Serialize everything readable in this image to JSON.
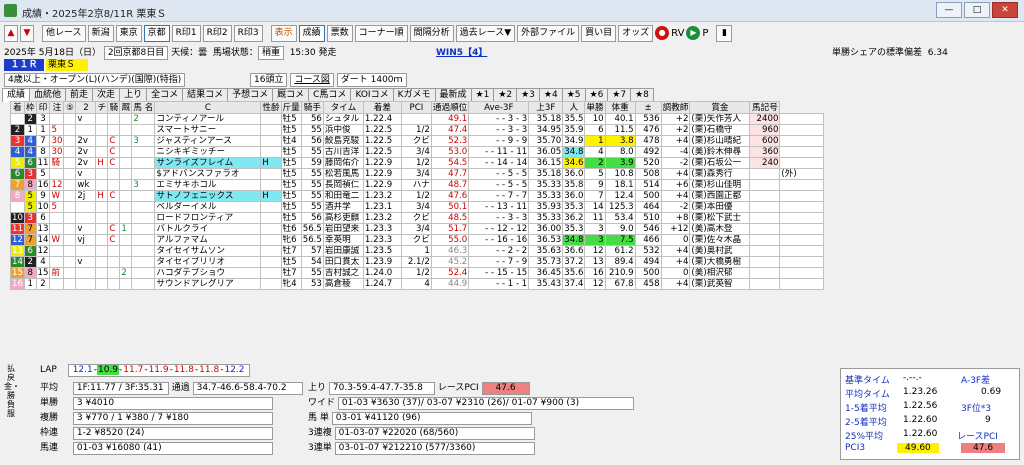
{
  "window": {
    "title": "成績・2025年2京8/11R 栗東Ｓ"
  },
  "toolbar": {
    "items": [
      "他レース",
      "新潟",
      "東京",
      "京都",
      "R印1",
      "R印2",
      "R印3",
      "表示",
      "成績",
      "票数",
      "コーナー順",
      "間隔分析",
      "過去レース▼",
      "外部ファイル",
      "買い目",
      "オッズ",
      "RV",
      "P"
    ]
  },
  "race": {
    "date": "2025年 5月18日（日）",
    "kai": "2回京都8日目",
    "weather_label": "天候：",
    "weather": "曇",
    "track_label": "馬場状態：",
    "track": "稍重",
    "start": "15:30 発走",
    "win5": "WIN5【4】",
    "share_label": "単勝シェアの標準偏差",
    "share": "6.34",
    "rno": "１１Ｒ",
    "name": "栗東Ｓ",
    "cond": "4歳以上・オープン(L)(ハンデ)(国際)(特指)",
    "heads": "16頭立",
    "course_btn": "コース図",
    "course": "ダート 1400ｍ"
  },
  "tabs": [
    "成績",
    "血統他",
    "前走",
    "次走",
    "上り",
    "全コメ",
    "結果コメ",
    "予想コメ",
    "厩コメ",
    "C馬コメ",
    "KOIコメ",
    "Kガメモ",
    "最新成",
    "★1",
    "★2",
    "★3",
    "★4",
    "★5",
    "★6",
    "★7",
    "★8"
  ],
  "columns": [
    "着",
    "枠",
    "印",
    "注",
    "⑤",
    "2",
    "チ",
    "騎",
    "厩",
    "馬 名",
    "C",
    "性齢",
    "斤量",
    "騎手",
    "タイム",
    "着差",
    "PCI",
    "通過順位",
    "Ave-3F",
    "上3F",
    "人",
    "単勝",
    "体重",
    "±",
    "調教師",
    "賞金",
    "馬記号"
  ],
  "rows": [
    {
      "ch": "1",
      "wak": "2",
      "ban": "3",
      "ma": "",
      "chu": "",
      "m5": "v",
      "m2": "",
      "chi": "",
      "ki": "",
      "kyu": "2",
      "name": "コンティノアール",
      "c": "",
      "sei": "牡5",
      "kin": "56",
      "jock": "シュタル",
      "time": "1.22.4",
      "sa": "",
      "pci": "49.1",
      "pass": "- - 3 - 3",
      "ave": "35.18",
      "up": "35.5",
      "nin": "10",
      "tan": "40.1",
      "wt": "536",
      "pm": "+2",
      "tr": "(栗)矢作芳人",
      "prize": "2400",
      "mark": ""
    },
    {
      "ch": "2",
      "wak": "1",
      "ban": "1",
      "ma": "5",
      "chu": "",
      "m5": "",
      "m2": "",
      "chi": "",
      "ki": "",
      "kyu": "",
      "name": "スマートサニー",
      "c": "",
      "sei": "牡5",
      "kin": "55",
      "jock": "浜中俊",
      "time": "1.22.5",
      "sa": "1/2",
      "pci": "47.4",
      "pass": "- - 3 - 3",
      "ave": "34.95",
      "up": "35.9",
      "nin": "6",
      "tan": "11.5",
      "wt": "476",
      "pm": "+2",
      "tr": "(栗)石橋守",
      "prize": "960",
      "mark": ""
    },
    {
      "ch": "3",
      "wak": "4",
      "ban": "7",
      "ma": "30",
      "chu": "",
      "m5": "2v",
      "m2": "",
      "chi": "C",
      "ki": "",
      "kyu": "3",
      "name": "ジャスティンアース",
      "c": "",
      "sei": "牡4",
      "kin": "56",
      "jock": "鮫島克駿",
      "time": "1.22.5",
      "sa": "クビ",
      "pci": "52.3",
      "pass": "- - 9 - 9",
      "ave": "35.70",
      "up": "34.9",
      "nin": "1",
      "tan": "3.8",
      "wt": "478",
      "pm": "+4",
      "tr": "(栗)杉山晴紀",
      "prize": "600",
      "mark": ""
    },
    {
      "ch": "4",
      "wak": "4",
      "ban": "8",
      "ma": "30",
      "chu": "",
      "m5": "2v",
      "m2": "",
      "chi": "C",
      "ki": "",
      "kyu": "",
      "name": "ニシキギミッチー",
      "c": "",
      "sei": "牡5",
      "kin": "55",
      "jock": "古川吉洋",
      "time": "1.22.5",
      "sa": "3/4",
      "pci": "53.0",
      "pass": "- - 11 - 11",
      "ave": "36.05",
      "up": "34.8",
      "nin": "4",
      "tan": "8.0",
      "wt": "492",
      "pm": "-4",
      "tr": "(美)鈴木伸尋",
      "prize": "360",
      "mark": ""
    },
    {
      "ch": "5",
      "wak": "6",
      "ban": "11",
      "ma": "騎",
      "chu": "",
      "m5": "2v",
      "m2": "H",
      "chi": "C",
      "ki": "",
      "kyu": "",
      "name": "サンライズフレイム",
      "c": "H",
      "sei": "牡5",
      "kin": "59",
      "jock": "藤岡佑介",
      "time": "1.22.9",
      "sa": "1/2",
      "pci": "54.5",
      "pass": "- - 14 - 14",
      "ave": "36.15",
      "up": "34.6",
      "nin": "2",
      "tan": "3.9",
      "wt": "520",
      "pm": "-2",
      "tr": "(栗)石坂公一",
      "prize": "240",
      "mark": ""
    },
    {
      "ch": "6",
      "wak": "3",
      "ban": "5",
      "ma": "",
      "chu": "",
      "m5": "v",
      "m2": "",
      "chi": "",
      "ki": "",
      "kyu": "",
      "name": "$アドバンスファラオ",
      "c": "",
      "sei": "牡5",
      "kin": "55",
      "jock": "松若風馬",
      "time": "1.22.9",
      "sa": "3/4",
      "pci": "47.7",
      "pass": "- - 5 - 5",
      "ave": "35.18",
      "up": "36.0",
      "nin": "5",
      "tan": "10.8",
      "wt": "508",
      "pm": "+4",
      "tr": "(栗)森秀行",
      "prize": "",
      "mark": "(外)"
    },
    {
      "ch": "7",
      "wak": "8",
      "ban": "16",
      "ma": "12",
      "chu": "",
      "m5": "wk",
      "m2": "",
      "chi": "",
      "ki": "",
      "kyu": "3",
      "name": "エミサキホコル",
      "c": "",
      "sei": "牡5",
      "kin": "55",
      "jock": "長岡禎仁",
      "time": "1.22.9",
      "sa": "ハナ",
      "pci": "48.7",
      "pass": "- - 5 - 5",
      "ave": "35.33",
      "up": "35.8",
      "nin": "9",
      "tan": "18.1",
      "wt": "514",
      "pm": "+6",
      "tr": "(栗)杉山佳明",
      "prize": "",
      "mark": ""
    },
    {
      "ch": "8",
      "wak": "5",
      "ban": "9",
      "ma": "W",
      "chu": "",
      "m5": "2j",
      "m2": "H",
      "chi": "C",
      "ki": "",
      "kyu": "",
      "name": "サトノフェニックス",
      "c": "H",
      "sei": "牡5",
      "kin": "55",
      "jock": "和田竜二",
      "time": "1.23.2",
      "sa": "1/2",
      "pci": "47.6",
      "pass": "- - 7 - 7",
      "ave": "35.33",
      "up": "36.0",
      "nin": "7",
      "tan": "12.4",
      "wt": "500",
      "pm": "+4",
      "tr": "(栗)西園正都",
      "prize": "",
      "mark": ""
    },
    {
      "ch": "9",
      "wak": "5",
      "ban": "10",
      "ma": "5",
      "chu": "",
      "m5": "",
      "m2": "",
      "chi": "",
      "ki": "",
      "kyu": "",
      "name": "ベルダーイメル",
      "c": "",
      "sei": "牡5",
      "kin": "55",
      "jock": "酒井学",
      "time": "1.23.1",
      "sa": "3/4",
      "pci": "50.1",
      "pass": "- - 13 - 11",
      "ave": "35.93",
      "up": "35.3",
      "nin": "14",
      "tan": "125.3",
      "wt": "464",
      "pm": "-2",
      "tr": "(栗)本田優",
      "prize": "",
      "mark": ""
    },
    {
      "ch": "10",
      "wak": "3",
      "ban": "6",
      "ma": "",
      "chu": "",
      "m5": "",
      "m2": "",
      "chi": "",
      "ki": "",
      "kyu": "",
      "name": "ロードフロンティア",
      "c": "",
      "sei": "牡5",
      "kin": "56",
      "jock": "高杉吏麒",
      "time": "1.23.2",
      "sa": "クビ",
      "pci": "48.5",
      "pass": "- - 3 - 3",
      "ave": "35.33",
      "up": "36.2",
      "nin": "11",
      "tan": "53.4",
      "wt": "510",
      "pm": "+8",
      "tr": "(栗)松下武士",
      "prize": "",
      "mark": ""
    },
    {
      "ch": "11",
      "wak": "7",
      "ban": "13",
      "ma": "",
      "chu": "",
      "m5": "v",
      "m2": "",
      "chi": "C",
      "ki": "1",
      "kyu": "",
      "name": "バトルクライ",
      "c": "",
      "sei": "牡6",
      "kin": "56.5",
      "jock": "岩田望来",
      "time": "1.23.3",
      "sa": "3/4",
      "pci": "51.7",
      "pass": "- - 12 - 12",
      "ave": "36.00",
      "up": "35.3",
      "nin": "3",
      "tan": "9.0",
      "wt": "546",
      "pm": "+12",
      "tr": "(美)高木登",
      "prize": "",
      "mark": ""
    },
    {
      "ch": "12",
      "wak": "7",
      "ban": "14",
      "ma": "W",
      "chu": "",
      "m5": "vj",
      "m2": "",
      "chi": "C",
      "ki": "",
      "kyu": "",
      "name": "アルファマム",
      "c": "",
      "sei": "牝6",
      "kin": "56.5",
      "jock": "幸英明",
      "time": "1.23.3",
      "sa": "クビ",
      "pci": "55.0",
      "pass": "- - 16 - 16",
      "ave": "36.53",
      "up": "34.8",
      "nin": "3",
      "tan": "7.5",
      "wt": "466",
      "pm": "0",
      "tr": "(栗)佐々木晶",
      "prize": "",
      "mark": ""
    },
    {
      "ch": "13",
      "wak": "6",
      "ban": "12",
      "ma": "",
      "chu": "",
      "m5": "",
      "m2": "",
      "chi": "",
      "ki": "",
      "kyu": "",
      "name": "タイセイサムソン",
      "c": "",
      "sei": "牡7",
      "kin": "57",
      "jock": "岩田康誠",
      "time": "1.23.5",
      "sa": "1",
      "pci": "46.3",
      "pass": "- - 2 - 2",
      "ave": "35.63",
      "up": "36.6",
      "nin": "12",
      "tan": "61.2",
      "wt": "532",
      "pm": "+4",
      "tr": "(美)奥村武",
      "prize": "",
      "mark": ""
    },
    {
      "ch": "14",
      "wak": "2",
      "ban": "4",
      "ma": "",
      "chu": "",
      "m5": "v",
      "m2": "",
      "chi": "",
      "ki": "",
      "kyu": "",
      "name": "タイセイブリリオ",
      "c": "",
      "sei": "牡5",
      "kin": "54",
      "jock": "田口貫太",
      "time": "1.23.9",
      "sa": "2.1/2",
      "pci": "45.2",
      "pass": "- - 7 - 9",
      "ave": "35.73",
      "up": "37.2",
      "nin": "13",
      "tan": "89.4",
      "wt": "494",
      "pm": "+4",
      "tr": "(栗)大橋勇樹",
      "prize": "",
      "mark": ""
    },
    {
      "ch": "15",
      "wak": "8",
      "ban": "15",
      "ma": "前",
      "chu": "",
      "m5": "",
      "m2": "",
      "chi": "",
      "ki": "2",
      "kyu": "",
      "name": "ハコダテブショウ",
      "c": "",
      "sei": "牡7",
      "kin": "55",
      "jock": "吉村誠之",
      "time": "1.24.0",
      "sa": "1/2",
      "pci": "52.4",
      "pass": "- - 15 - 15",
      "ave": "36.45",
      "up": "35.6",
      "nin": "16",
      "tan": "210.9",
      "wt": "500",
      "pm": "0",
      "tr": "(美)相沢郁",
      "prize": "",
      "mark": ""
    },
    {
      "ch": "16",
      "wak": "1",
      "ban": "2",
      "ma": "",
      "chu": "",
      "m5": "",
      "m2": "",
      "chi": "",
      "ki": "",
      "kyu": "",
      "name": "サウンドアレグリア",
      "c": "",
      "sei": "牝4",
      "kin": "53",
      "jock": "高倉稜",
      "time": "1.24.7",
      "sa": "4",
      "pci": "44.9",
      "pass": "- - 1 - 1",
      "ave": "35.43",
      "up": "37.4",
      "nin": "12",
      "tan": "67.8",
      "wt": "458",
      "pm": "+4",
      "tr": "(栗)武英智",
      "prize": "",
      "mark": ""
    }
  ],
  "bottom": {
    "vlabel": "払戻金・勝負服",
    "lap_label": "LAP",
    "laps": [
      "12.1",
      "10.9",
      "11.7",
      "11.9",
      "11.8",
      "11.8",
      "12.2"
    ],
    "avg_label": "平均",
    "avg": "1F:11.77 / 3F:35.31",
    "pass_label": "通過",
    "pass": "34.7-46.6-58.4-70.2",
    "agari_label": "上り",
    "agari": "70.3-59.4-47.7-35.8",
    "rpci_label": "レースPCI",
    "rpci": "47.6",
    "tan_label": "単勝",
    "tan": "3 ¥4010",
    "fuku_label": "複勝",
    "fuku": "3 ¥770 / 1 ¥380 / 7 ¥180",
    "wakuren_label": "枠連",
    "wakuren": "1-2 ¥8520 (24)",
    "umaren_label": "馬連",
    "umaren": "01-03 ¥16080 (41)",
    "wide_label": "ワイド",
    "wide": "01-03 ¥3630 (37)/ 03-07 ¥2310 (26)/ 01-07 ¥900 (3)",
    "umatan_label": "馬 単",
    "umatan": "03-01 ¥41120 (96)",
    "sanrenpuku_label": "3連複",
    "sanrenpuku": "01-03-07 ¥22020 (68/560)",
    "sanrentan_label": "3連単",
    "sanrentan": "03-01-07 ¥212210 (577/3360)"
  },
  "stats": {
    "kijun_label": "基準タイム",
    "kijun": "-.--.-",
    "a3f_label": "A-3F差",
    "a3f": "0.69",
    "avgtime_label": "平均タイム",
    "avgtime": "1.23.26",
    "avg15_label": "1-5着平均",
    "avg15": "1.22.56",
    "f3pos_label": "3F位*3",
    "f3pos": "9",
    "avg25_label": "2-5着平均",
    "avg25": "1.22.60",
    "avg25p_label": "25%平均",
    "avg25p": "1.22.60",
    "rpci_label": "レースPCI",
    "pci3_label": "PCI3",
    "pci3": "49.60",
    "rpci": "47.6"
  }
}
